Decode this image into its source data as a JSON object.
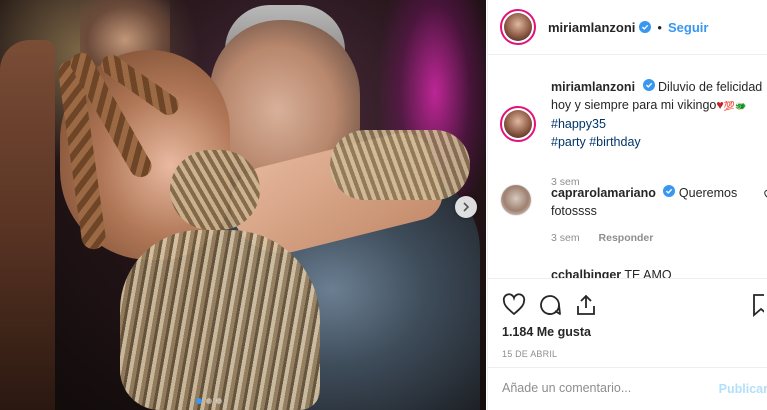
{
  "post": {
    "username": "miriamlanzoni",
    "follow_label": "Seguir",
    "separator": "•",
    "caption_text": "Diluvio de felicidad hoy y siempre para mi vikingo",
    "caption_emoji": "♥",
    "caption_extra": "💯🐲",
    "hashtags": [
      "#happy35",
      "#party",
      "#birthday"
    ],
    "caption_time": "3 sem",
    "photo_icons": [
      "chevron-right-icon"
    ],
    "carousel_dots": 3,
    "carousel_active": 0
  },
  "comments": [
    {
      "username": "caprarolamariano",
      "text": "Queremos fotossss",
      "time": "3 sem",
      "reply_label": "Responder"
    },
    {
      "username": "cchalbinger",
      "text": "TE AMO"
    }
  ],
  "actions": {
    "icons": [
      "heart-icon",
      "comment-icon",
      "share-icon",
      "bookmark-icon"
    ],
    "likes_label": "1.184 Me gusta",
    "date": "15 DE ABRIL"
  },
  "add_comment": {
    "placeholder": "Añade un comentario...",
    "publish_label": "Publicar"
  },
  "colors": {
    "accent": "#3897f0",
    "hashtag": "#003569",
    "muted": "#8e8e8e",
    "publish_disabled": "#b2dffc"
  }
}
